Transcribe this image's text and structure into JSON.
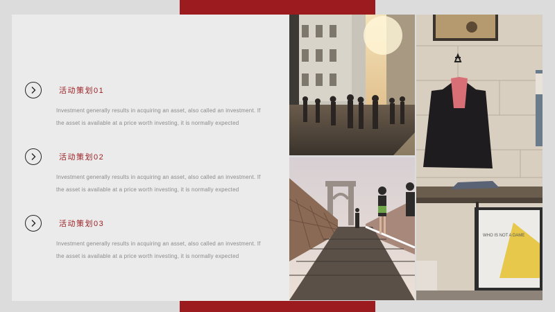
{
  "items": [
    {
      "title": "活动策划01",
      "description": "Investment generally results in acquiring an asset, also called an investment. If the asset is available at a price worth investing, it is normally expected"
    },
    {
      "title": "活动策划02",
      "description": "Investment generally results in acquiring an asset, also called an investment. If the asset is available at a price worth investing, it is normally expected"
    },
    {
      "title": "活动策划03",
      "description": "Investment generally results in acquiring an asset, also called an investment. If the asset is available at a price worth investing, it is normally expected"
    }
  ],
  "icons": {
    "item_icon": "chevron-right-circle-icon"
  },
  "colors": {
    "accent": "#9b1b1f",
    "panel": "#ebebeb",
    "background": "#dcdcdc"
  },
  "photos": {
    "poster_text": "WHO IS NOT A DAME"
  }
}
